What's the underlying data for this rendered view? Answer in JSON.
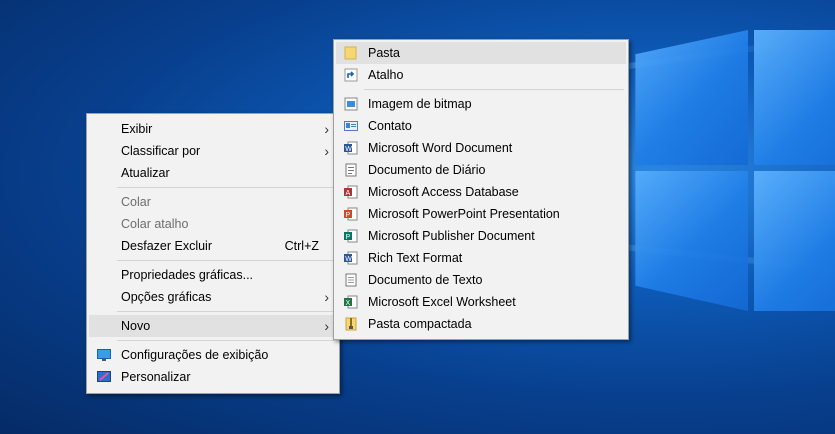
{
  "context_menu": {
    "items": [
      {
        "label": "Exibir",
        "submenu": true
      },
      {
        "label": "Classificar por",
        "submenu": true
      },
      {
        "label": "Atualizar"
      },
      {
        "label": "Colar",
        "disabled": true
      },
      {
        "label": "Colar atalho",
        "disabled": true
      },
      {
        "label": "Desfazer Excluir",
        "shortcut": "Ctrl+Z"
      },
      {
        "label": "Propriedades gráficas..."
      },
      {
        "label": "Opções gráficas",
        "submenu": true
      },
      {
        "label": "Novo",
        "submenu": true,
        "highlighted": true
      },
      {
        "label": "Configurações de exibição",
        "icon": "display-settings-icon"
      },
      {
        "label": "Personalizar",
        "icon": "personalize-icon"
      }
    ]
  },
  "submenu_novo": {
    "items": [
      {
        "label": "Pasta",
        "icon": "folder-icon",
        "highlighted": true
      },
      {
        "label": "Atalho",
        "icon": "shortcut-icon"
      },
      {
        "label": "Imagem de bitmap",
        "icon": "bitmap-icon"
      },
      {
        "label": "Contato",
        "icon": "contact-icon"
      },
      {
        "label": "Microsoft Word Document",
        "icon": "word-icon"
      },
      {
        "label": "Documento de Diário",
        "icon": "journal-icon"
      },
      {
        "label": "Microsoft Access Database",
        "icon": "access-icon"
      },
      {
        "label": "Microsoft PowerPoint Presentation",
        "icon": "powerpoint-icon"
      },
      {
        "label": "Microsoft Publisher Document",
        "icon": "publisher-icon"
      },
      {
        "label": "Rich Text Format",
        "icon": "rtf-icon"
      },
      {
        "label": "Documento de Texto",
        "icon": "text-document-icon"
      },
      {
        "label": "Microsoft Excel Worksheet",
        "icon": "excel-icon"
      },
      {
        "label": "Pasta compactada",
        "icon": "zip-folder-icon"
      }
    ]
  },
  "colors": {
    "menu_bg": "#f2f2f2",
    "highlight": "#e1e1e1",
    "desktop_blue": "#0d5bb8"
  }
}
